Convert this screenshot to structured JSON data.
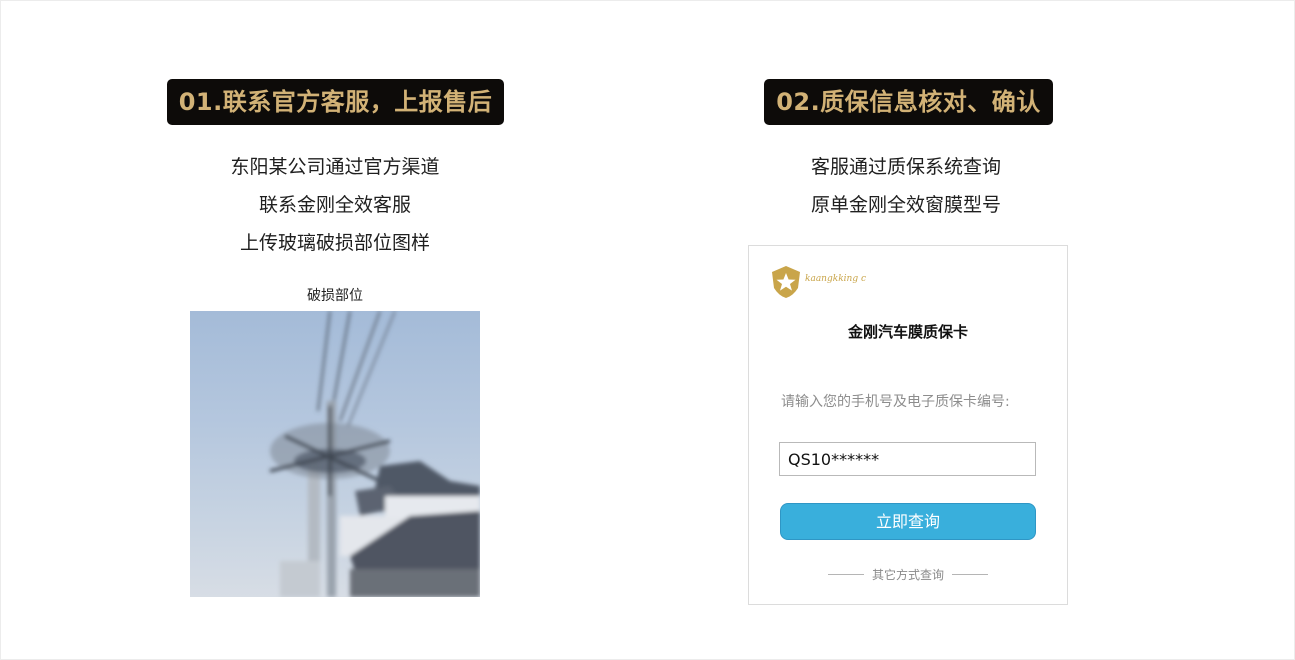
{
  "step1": {
    "badge": "01.联系官方客服，上报售后",
    "lines": [
      "东阳某公司通过官方渠道",
      "联系金刚全效客服",
      "上传玻璃破损部位图样"
    ],
    "photo_caption": "破损部位"
  },
  "step2": {
    "badge": "02.质保信息核对、确认",
    "lines": [
      "客服通过质保系统查询",
      "原单金刚全效窗膜型号"
    ]
  },
  "card": {
    "logo_text": "kaangkking c",
    "title": "金刚汽车膜质保卡",
    "input_label": "请输入您的手机号及电子质保卡编号:",
    "input_value": "QS10******",
    "query_button": "立即查询",
    "other_link": "其它方式查询"
  },
  "colors": {
    "badge_bg": "#0d0b09",
    "badge_text": "#d2b276",
    "button_bg": "#39afdc",
    "logo_gold": "#c9a54a"
  }
}
